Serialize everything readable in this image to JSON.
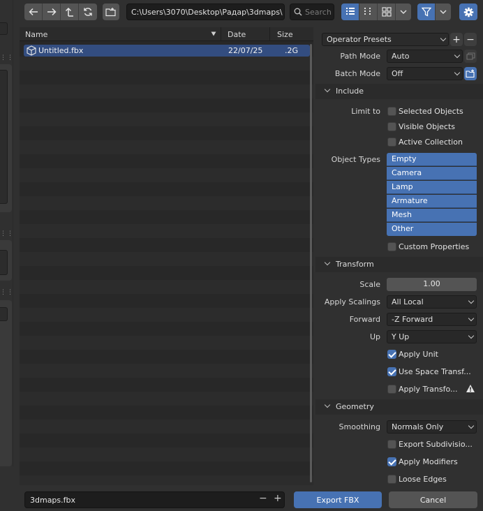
{
  "toolbar": {
    "path": "C:\\Users\\3070\\Desktop\\Радар\\3dmaps\\",
    "search_placeholder": "Search"
  },
  "file_list": {
    "columns": [
      "Name",
      "Date",
      "Size"
    ],
    "files": [
      {
        "name": "Untitled.fbx",
        "date": "22/07/25",
        "size": ".2G",
        "selected": true
      }
    ]
  },
  "bottom": {
    "filename": "3dmaps.fbx",
    "export_label": "Export FBX",
    "cancel_label": "Cancel"
  },
  "options": {
    "operator_presets": "Operator Presets",
    "path_mode_label": "Path Mode",
    "path_mode_value": "Auto",
    "batch_mode_label": "Batch Mode",
    "batch_mode_value": "Off",
    "include": {
      "title": "Include",
      "limit_to_label": "Limit to",
      "selected_objects": {
        "label": "Selected Objects",
        "checked": false
      },
      "visible_objects": {
        "label": "Visible Objects",
        "checked": false
      },
      "active_collection": {
        "label": "Active Collection",
        "checked": false
      },
      "object_types_label": "Object Types",
      "object_types": [
        "Empty",
        "Camera",
        "Lamp",
        "Armature",
        "Mesh",
        "Other"
      ],
      "custom_properties": {
        "label": "Custom Properties",
        "checked": false
      }
    },
    "transform": {
      "title": "Transform",
      "scale_label": "Scale",
      "scale_value": "1.00",
      "apply_scalings_label": "Apply Scalings",
      "apply_scalings_value": "All Local",
      "forward_label": "Forward",
      "forward_value": "-Z Forward",
      "up_label": "Up",
      "up_value": "Y Up",
      "apply_unit": {
        "label": "Apply Unit",
        "checked": true
      },
      "use_space_transform": {
        "label": "Use Space Transf...",
        "checked": true
      },
      "apply_transform": {
        "label": "Apply Transfo...",
        "checked": false
      }
    },
    "geometry": {
      "title": "Geometry",
      "smoothing_label": "Smoothing",
      "smoothing_value": "Normals Only",
      "export_subdivision": {
        "label": "Export Subdivisio...",
        "checked": false
      },
      "apply_modifiers": {
        "label": "Apply Modifiers",
        "checked": true
      },
      "loose_edges": {
        "label": "Loose Edges",
        "checked": false
      }
    }
  },
  "colors": {
    "accent": "#4772b3",
    "selection": "#334d80",
    "background": "#303030",
    "list_background": "#282828"
  }
}
